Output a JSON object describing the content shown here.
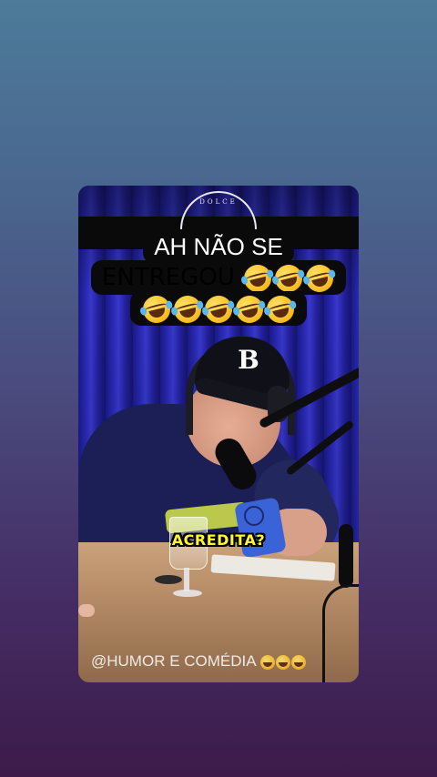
{
  "post": {
    "channel_logo_text": "DOLCE",
    "caption": {
      "line1": "AH NÃO SE",
      "line2": "ENTREGOU",
      "line2_emoji_count": 3,
      "line3_emoji_count": 5,
      "emoji_icon": "rolling-on-floor-laughing-icon"
    },
    "subtitle": "ACREDITA?",
    "cap_logo": "B",
    "watermark": {
      "text": "@HUMOR E COMÉDIA",
      "emoji_count": 3,
      "emoji_icon": "tears-of-joy-icon"
    }
  },
  "colors": {
    "background_top": "#4d7b99",
    "background_bottom": "#3d1a4a",
    "subtitle": "#fff533",
    "caption_bg": "#0a0a0a"
  }
}
